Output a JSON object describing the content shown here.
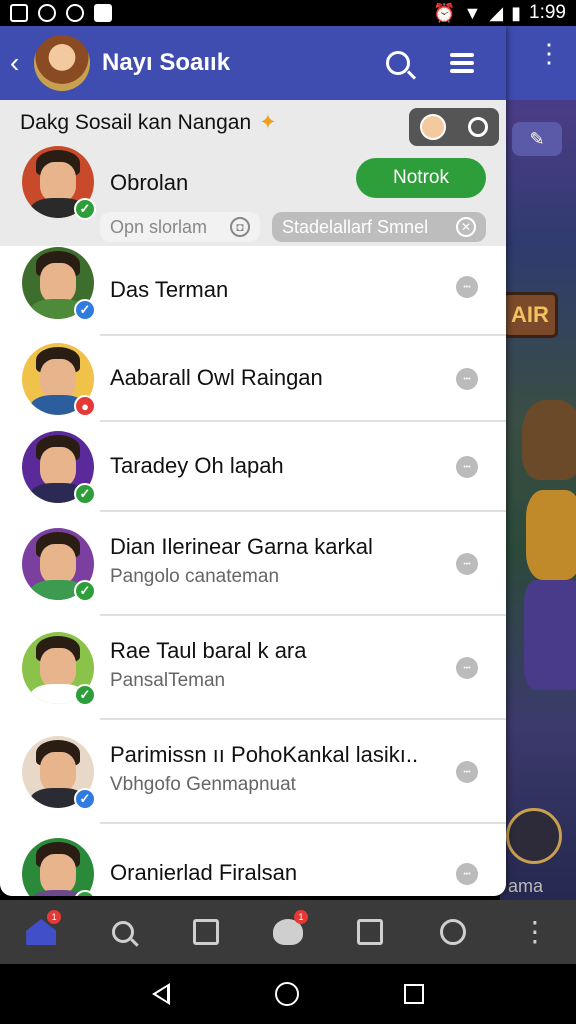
{
  "status_bar": {
    "time": "1:99"
  },
  "header": {
    "title": "Nayı Soaıık"
  },
  "top_card": {
    "title": "Dakg Sosail kan Nangan",
    "featured_name": "Obrolan",
    "action_label": "Notrok",
    "pill_left": "Opn slorlam",
    "pill_right": "Stadelallarf Smnel"
  },
  "contacts": [
    {
      "title": "Das Terman",
      "subtitle": "",
      "status": "verified",
      "shirt": "#4d8a3a"
    },
    {
      "title": "Aabarall Owl Raingan",
      "subtitle": "",
      "status": "busy",
      "shirt": "#2c5e9e"
    },
    {
      "title": "Taradey Oh lapah",
      "subtitle": "",
      "status": "online",
      "shirt": "#2a2a55"
    },
    {
      "title": "Dian Ilerinear Garna karkal",
      "subtitle": "Pangolo canateman",
      "status": "online",
      "shirt": "#3c9b4e"
    },
    {
      "title": "Rae Taul baral k ara",
      "subtitle": "PansalTeman",
      "status": "online",
      "shirt": "#ffffff"
    },
    {
      "title": "Parimissn ıı PohoKankal lasikı..",
      "subtitle": "Vbhgofo Genmapnuat",
      "status": "verified",
      "shirt": "#2b2b33"
    },
    {
      "title": "Oranierlad Firalsan",
      "subtitle": "",
      "status": "online",
      "shirt": "#6a4a8a"
    }
  ],
  "bottom_nav": {
    "home_badge": "1",
    "notif_badge": "1"
  },
  "game": {
    "sign_text": "AIR",
    "label": "ama"
  },
  "colors": {
    "primary": "#3f4db0",
    "green": "#2e9e3a",
    "verified": "#2f7be0",
    "busy": "#e53935"
  }
}
